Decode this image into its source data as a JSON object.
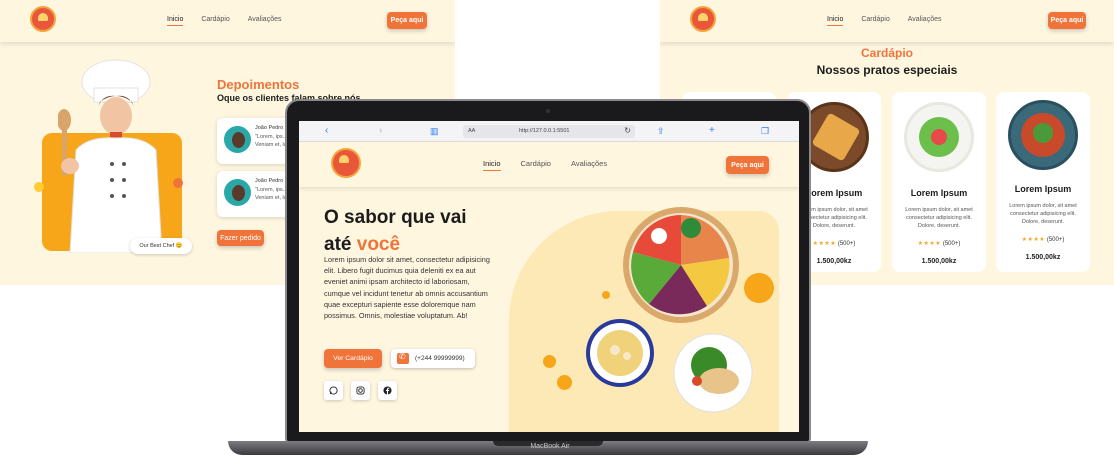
{
  "left_site": {
    "nav": [
      "Inicio",
      "Cardápio",
      "Avaliações"
    ],
    "order_button": "Peça aqui",
    "section_title": "Depoimentos",
    "section_subtitle": "Oque os clientes falam sobre nós",
    "testimonials": [
      {
        "name": "João Pedro",
        "text": "\"Lorem, ips... Veniam et, labore!\""
      },
      {
        "name": "João Pedro",
        "text": "\"Lorem, ips... Veniam et, labore!\""
      }
    ],
    "best_chef_label": "Our Best Chef 😊",
    "order_cta": "Fazer pedido"
  },
  "right_site": {
    "nav": [
      "Inicio",
      "Cardápio",
      "Avaliações"
    ],
    "order_button": "Peça aqui",
    "section_title": "Cardápio",
    "section_subtitle": "Nossos pratos especiais",
    "dishes": [
      {
        "name": "Lorem Ipsum",
        "desc": "Lorem ipsum dolor, sit amet consectetur adipisicing elit. Dolore, deserunt.",
        "stars": "★★★★",
        "rating": "(500+)",
        "price": "1.500,00kz"
      },
      {
        "name": "Lorem Ipsum",
        "desc": "Lorem ipsum dolor, sit amet consectetur adipisicing elit. Dolore, deserunt.",
        "stars": "★★★★",
        "rating": "(500+)",
        "price": "1.500,00kz"
      },
      {
        "name": "Lorem Ipsum",
        "desc": "Lorem ipsum dolor, sit amet consectetur adipisicing elit. Dolore, deserunt.",
        "stars": "★★★★",
        "rating": "(500+)",
        "price": "1.500,00kz"
      }
    ]
  },
  "browser": {
    "text_size_label": "AA",
    "url": "http://127.0.0.1:5501"
  },
  "inner_site": {
    "nav": [
      "Inicio",
      "Cardápio",
      "Avaliações"
    ],
    "order_button": "Peça aqui",
    "hero_title_line1": "O sabor que vai",
    "hero_title_line2_a": "até ",
    "hero_title_line2_b": "você",
    "hero_text": "Lorem ipsum dolor sit amet, consectetur adipisicing elit. Libero fugit ducimus quia deleniti ex ea aut eveniet animi ipsam architecto id laboriosam, cumque vel incidunt tenetur ab omnis accusantium quae excepturi sapiente esse doloremque nam possimus. Omnis, molestiae voluptatum. Ab!",
    "menu_button": "Ver Cardápio",
    "phone": "(+244 99999999)"
  },
  "device_label": "MacBook Air",
  "colors": {
    "accent": "#f0743a",
    "background": "#fff6e0",
    "highlight": "#f7a61a"
  }
}
